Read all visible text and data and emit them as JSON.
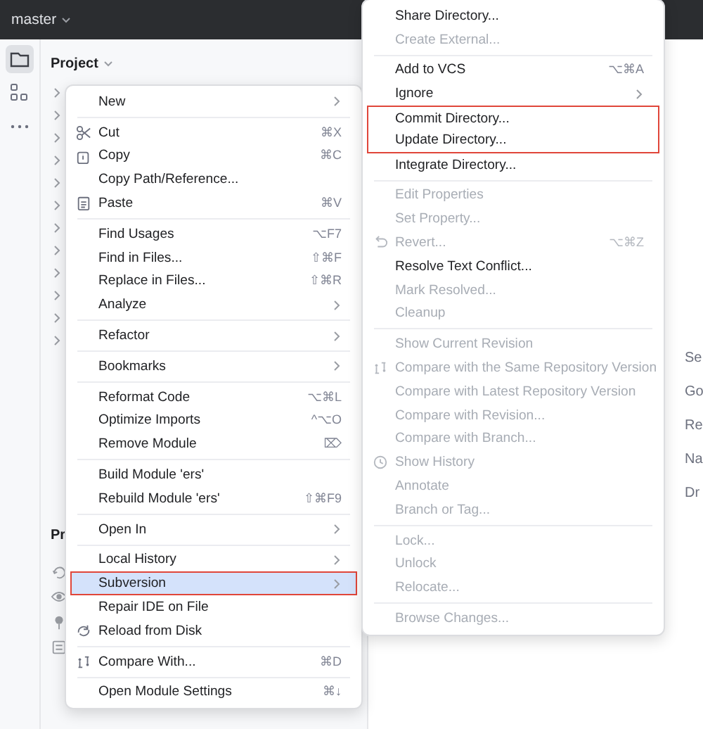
{
  "top_bar": {
    "branch": "master"
  },
  "tool_strip": [
    {
      "selected": true
    },
    {
      "selected": false
    },
    {
      "selected": false
    }
  ],
  "project_panel": {
    "title": "Project",
    "tree": [
      {
        "expanded": false
      },
      {
        "expanded": false
      },
      {
        "expanded": false
      },
      {
        "expanded": false
      },
      {
        "expanded": false
      },
      {
        "expanded": false
      },
      {
        "expanded": false
      },
      {
        "expanded": false
      },
      {
        "expanded": false
      },
      {
        "expanded": false
      },
      {
        "expanded": false
      },
      {
        "expanded": false
      }
    ]
  },
  "lower_panel": {
    "title": "Pr"
  },
  "editor_hints": [
    "Se",
    "Go",
    "Re",
    "Na",
    "Dr"
  ],
  "context_menu": {
    "sections": [
      [
        {
          "label": "New",
          "kind": "submenu",
          "disabled": false,
          "selected": false,
          "outlined": false
        }
      ],
      [
        {
          "label": "Cut",
          "shortcut": "⌘X",
          "kind": "action",
          "disabled": false,
          "selected": false,
          "outlined": false
        },
        {
          "label": "Copy",
          "shortcut": "⌘C",
          "kind": "action",
          "disabled": false,
          "selected": false,
          "outlined": false
        },
        {
          "label": "Copy Path/Reference...",
          "kind": "action",
          "disabled": false,
          "selected": false,
          "outlined": false
        },
        {
          "label": "Paste",
          "shortcut": "⌘V",
          "kind": "action",
          "disabled": false,
          "selected": false,
          "outlined": false
        }
      ],
      [
        {
          "label": "Find Usages",
          "shortcut": "⌥F7",
          "kind": "action",
          "disabled": false,
          "selected": false,
          "outlined": false
        },
        {
          "label": "Find in Files...",
          "shortcut": "⇧⌘F",
          "kind": "action",
          "disabled": false,
          "selected": false,
          "outlined": false
        },
        {
          "label": "Replace in Files...",
          "shortcut": "⇧⌘R",
          "kind": "action",
          "disabled": false,
          "selected": false,
          "outlined": false
        },
        {
          "label": "Analyze",
          "kind": "submenu",
          "disabled": false,
          "selected": false,
          "outlined": false
        }
      ],
      [
        {
          "label": "Refactor",
          "kind": "submenu",
          "disabled": false,
          "selected": false,
          "outlined": false
        }
      ],
      [
        {
          "label": "Bookmarks",
          "kind": "submenu",
          "disabled": false,
          "selected": false,
          "outlined": false
        }
      ],
      [
        {
          "label": "Reformat Code",
          "shortcut": "⌥⌘L",
          "kind": "action",
          "disabled": false,
          "selected": false,
          "outlined": false
        },
        {
          "label": "Optimize Imports",
          "shortcut": "^⌥O",
          "kind": "action",
          "disabled": false,
          "selected": false,
          "outlined": false
        },
        {
          "label": "Remove Module",
          "shortcut": "⌦",
          "kind": "action",
          "disabled": false,
          "selected": false,
          "outlined": false
        }
      ],
      [
        {
          "label": "Build Module 'ers'",
          "kind": "action",
          "disabled": false,
          "selected": false,
          "outlined": false
        },
        {
          "label": "Rebuild Module 'ers'",
          "shortcut": "⇧⌘F9",
          "kind": "action",
          "disabled": false,
          "selected": false,
          "outlined": false
        }
      ],
      [
        {
          "label": "Open In",
          "kind": "submenu",
          "disabled": false,
          "selected": false,
          "outlined": false
        }
      ],
      [
        {
          "label": "Local History",
          "kind": "submenu",
          "disabled": false,
          "selected": false,
          "outlined": false
        },
        {
          "label": "Subversion",
          "kind": "submenu",
          "disabled": false,
          "selected": true,
          "outlined": true
        },
        {
          "label": "Repair IDE on File",
          "kind": "action",
          "disabled": false,
          "selected": false,
          "outlined": false
        },
        {
          "label": "Reload from Disk",
          "kind": "action",
          "disabled": false,
          "selected": false,
          "outlined": false
        }
      ],
      [
        {
          "label": "Compare With...",
          "shortcut": "⌘D",
          "kind": "action",
          "disabled": false,
          "selected": false,
          "outlined": false
        }
      ],
      [
        {
          "label": "Open Module Settings",
          "shortcut": "⌘↓",
          "kind": "action",
          "disabled": false,
          "selected": false,
          "outlined": false
        }
      ]
    ]
  },
  "submenu": {
    "sections": [
      [
        {
          "label": "Share Directory...",
          "kind": "action",
          "disabled": false,
          "selected": false,
          "outlined": false
        },
        {
          "label": "Create External...",
          "kind": "action",
          "disabled": true,
          "selected": false,
          "outlined": false
        }
      ],
      [
        {
          "label": "Add to VCS",
          "shortcut": "⌥⌘A",
          "kind": "action",
          "disabled": false,
          "selected": false,
          "outlined": false
        },
        {
          "label": "Ignore",
          "kind": "submenu",
          "disabled": false,
          "selected": false,
          "outlined": false
        },
        {
          "label": "Commit Directory...",
          "kind": "action",
          "disabled": false,
          "selected": false,
          "outlined": true
        },
        {
          "label": "Update Directory...",
          "kind": "action",
          "disabled": false,
          "selected": false,
          "outlined": true
        },
        {
          "label": "Integrate Directory...",
          "kind": "action",
          "disabled": false,
          "selected": false,
          "outlined": false
        }
      ],
      [
        {
          "label": "Edit Properties",
          "kind": "action",
          "disabled": true,
          "selected": false,
          "outlined": false
        },
        {
          "label": "Set Property...",
          "kind": "action",
          "disabled": true,
          "selected": false,
          "outlined": false
        },
        {
          "label": "Revert...",
          "shortcut": "⌥⌘Z",
          "kind": "action",
          "disabled": true,
          "selected": false,
          "outlined": false
        },
        {
          "label": "Resolve Text Conflict...",
          "kind": "action",
          "disabled": false,
          "selected": false,
          "outlined": false
        },
        {
          "label": "Mark Resolved...",
          "kind": "action",
          "disabled": true,
          "selected": false,
          "outlined": false
        },
        {
          "label": "Cleanup",
          "kind": "action",
          "disabled": true,
          "selected": false,
          "outlined": false
        }
      ],
      [
        {
          "label": "Show Current Revision",
          "kind": "action",
          "disabled": true,
          "selected": false,
          "outlined": false
        },
        {
          "label": "Compare with the Same Repository Version",
          "kind": "action",
          "disabled": true,
          "selected": false,
          "outlined": false
        },
        {
          "label": "Compare with Latest Repository Version",
          "kind": "action",
          "disabled": true,
          "selected": false,
          "outlined": false
        },
        {
          "label": "Compare with Revision...",
          "kind": "action",
          "disabled": true,
          "selected": false,
          "outlined": false
        },
        {
          "label": "Compare with Branch...",
          "kind": "action",
          "disabled": true,
          "selected": false,
          "outlined": false
        },
        {
          "label": "Show History",
          "kind": "action",
          "disabled": true,
          "selected": false,
          "outlined": false
        },
        {
          "label": "Annotate",
          "kind": "action",
          "disabled": true,
          "selected": false,
          "outlined": false
        },
        {
          "label": "Branch or Tag...",
          "kind": "action",
          "disabled": true,
          "selected": false,
          "outlined": false
        }
      ],
      [
        {
          "label": "Lock...",
          "kind": "action",
          "disabled": true,
          "selected": false,
          "outlined": false
        },
        {
          "label": "Unlock",
          "kind": "action",
          "disabled": true,
          "selected": false,
          "outlined": false
        },
        {
          "label": "Relocate...",
          "kind": "action",
          "disabled": true,
          "selected": false,
          "outlined": false
        }
      ],
      [
        {
          "label": "Browse Changes...",
          "kind": "action",
          "disabled": true,
          "selected": false,
          "outlined": false
        }
      ]
    ]
  }
}
